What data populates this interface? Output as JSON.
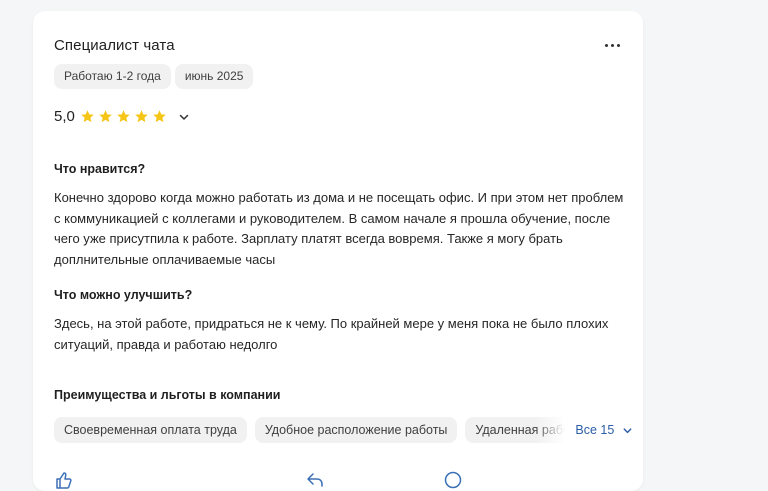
{
  "review": {
    "title": "Специалист чата",
    "tags": [
      "Работаю 1-2 года",
      "июнь 2025"
    ],
    "rating": {
      "value": "5,0",
      "stars": 5,
      "star_color": "#f5c518"
    },
    "likes": {
      "heading": "Что нравится?",
      "text": "Конечно здорово когда можно работать из дома и не посещать офис. И при этом нет проблем с коммуникацией с коллегами и руководителем. В самом начале я прошла обучение, после чего уже присутпила к работе. Зарплату платят всегда вовремя. Также я могу брать доплнительные оплачиваемые часы"
    },
    "improve": {
      "heading": "Что можно улучшить?",
      "text": "Здесь, на этой работе, придраться не к чему. По крайней мере у меня пока не было плохих ситуаций, правда и работаю недолго"
    },
    "benefits": {
      "heading": "Преимущества и льготы в компании",
      "items": [
        "Своевременная оплата труда",
        "Удобное расположение работы",
        "Удаленная работа"
      ],
      "show_all_label": "Все 15"
    }
  },
  "colors": {
    "link": "#2b5ea7",
    "chip_bg": "#f1f1f1",
    "page_bg": "#f4f6f7"
  },
  "icons": {
    "more": "more-horizontal-icon",
    "expand": "chevron-down-icon",
    "star": "star-icon"
  }
}
